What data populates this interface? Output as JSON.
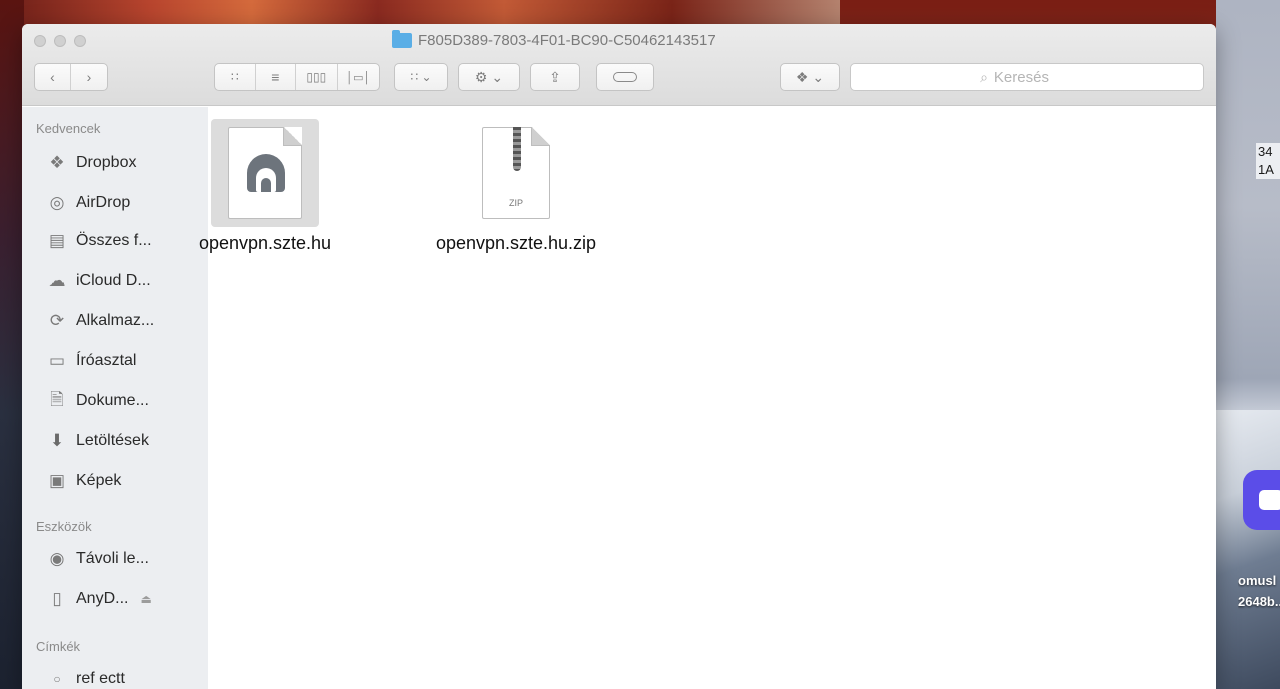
{
  "desktop": {
    "label_top": "34\n1A",
    "label_bottom": "omusl\n2648b.."
  },
  "window": {
    "title": "F805D389-7803-4F01-BC90-C50462143517",
    "toolbar": {
      "back_icon": "chevron-left-icon",
      "forward_icon": "chevron-right-icon",
      "view_icons": [
        "icon-view",
        "list-view",
        "column-view",
        "cover-flow-view"
      ],
      "group_icon": "group-by-icon",
      "action_icon": "gear-icon",
      "share_icon": "share-icon",
      "tag_icon": "tag-icon",
      "dropbox_icon": "dropbox-icon"
    },
    "search": {
      "placeholder": "Keresés",
      "value": ""
    }
  },
  "sidebar": {
    "sections": [
      {
        "title": "Kedvencek",
        "items": [
          {
            "label": "Dropbox",
            "icon": "dropbox-icon"
          },
          {
            "label": "AirDrop",
            "icon": "airdrop-icon"
          },
          {
            "label": "Összes f...",
            "icon": "all-files-icon"
          },
          {
            "label": "iCloud D...",
            "icon": "cloud-icon"
          },
          {
            "label": "Alkalmaz...",
            "icon": "applications-icon"
          },
          {
            "label": "Íróasztal",
            "icon": "desktop-icon"
          },
          {
            "label": "Dokume...",
            "icon": "documents-icon"
          },
          {
            "label": "Letöltések",
            "icon": "downloads-icon"
          },
          {
            "label": "Képek",
            "icon": "camera-icon"
          }
        ]
      },
      {
        "title": "Eszközök",
        "items": [
          {
            "label": "Távoli le...",
            "icon": "disc-icon"
          },
          {
            "label": "AnyD...",
            "icon": "drive-icon"
          }
        ]
      },
      {
        "title": "Címkék",
        "items": [
          {
            "label": "ref ectt",
            "icon": "tag-circle-icon"
          }
        ]
      }
    ]
  },
  "files": [
    {
      "name": "openvpn.szte.hu",
      "type": "tunnelblick-config",
      "selected": true
    },
    {
      "name": "openvpn.szte.hu.zip",
      "type": "zip",
      "badge": "ZIP",
      "selected": false
    }
  ]
}
